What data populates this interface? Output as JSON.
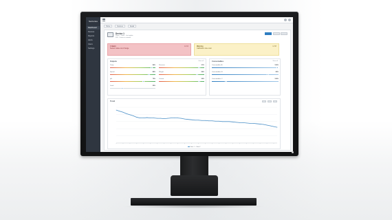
{
  "app": {
    "brand": "Sartorius",
    "colors": {
      "accent": "#2f7ec1",
      "sidebar": "#2f3640",
      "alert_red": "#f3c2c5",
      "alert_yellow": "#fbf1c7"
    }
  },
  "sidebar": {
    "items": [
      {
        "label": "Dashboard",
        "active": true
      },
      {
        "label": "Devices",
        "active": false
      },
      {
        "label": "Reports",
        "active": false
      },
      {
        "label": "Alerts",
        "active": false
      },
      {
        "label": "Users",
        "active": false
      },
      {
        "label": "Settings",
        "active": false
      }
    ]
  },
  "topbar": {
    "icons": [
      "menu-icon",
      "search-icon",
      "user-icon"
    ]
  },
  "breadcrumb": [
    "Home",
    "Devices",
    "Detail"
  ],
  "device": {
    "title": "Device 1",
    "subtitle": "Status · Online · Last update",
    "subtitle2": "S/N · 1 device in network"
  },
  "alerts": {
    "red": {
      "title": "1 Alarm",
      "text": "Sensor value out of range",
      "time": "12:04"
    },
    "yellow": {
      "title": "Warning",
      "text": "Calibration due soon",
      "time": "11:58"
    }
  },
  "panel_left": {
    "title": "Outputs",
    "link": "Show all",
    "metrics": [
      {
        "label": "Temp",
        "value": "94%",
        "level": 0.94
      },
      {
        "label": "Speed",
        "value": "88%",
        "level": 0.88
      },
      {
        "label": "pH",
        "value": "75%",
        "level": 0.75
      },
      {
        "label": "Pressure",
        "value": "91%",
        "level": 0.91
      },
      {
        "label": "Weight",
        "value": "86%",
        "level": 0.86
      },
      {
        "label": "Current",
        "value": "90%",
        "level": 0.9
      },
      {
        "label": "Level",
        "value": "25%",
        "level": 0.25
      }
    ]
  },
  "panel_right": {
    "title": "Consumables",
    "link": "Show all",
    "metrics": [
      {
        "label": "Consumables A",
        "value": "100%",
        "level": 1.0
      },
      {
        "label": "Consumables B",
        "value": "85%",
        "level": 0.85
      },
      {
        "label": "Consumables C",
        "value": "100%",
        "level": 0.2
      }
    ]
  },
  "trend": {
    "title": "Trend",
    "legend": "Value 1 — Value 2",
    "tools": [
      "zoom",
      "range",
      "export"
    ]
  },
  "chart_data": {
    "type": "line",
    "title": "Trend",
    "xlabel": "",
    "ylabel": "",
    "ylim": [
      0,
      100
    ],
    "x": [
      1,
      2,
      3,
      4,
      5,
      6,
      7,
      8,
      9,
      10,
      11,
      12,
      13,
      14,
      15,
      16,
      17,
      18,
      19,
      20,
      21,
      22,
      23,
      24,
      25,
      26,
      27,
      28,
      29,
      30,
      31,
      32,
      33,
      34,
      35,
      36,
      37,
      38,
      39,
      40,
      41,
      42,
      43,
      44,
      45,
      46,
      47,
      48
    ],
    "series": [
      {
        "values": [
          92,
          89,
          86,
          82,
          79,
          76,
          72,
          70,
          70,
          71,
          70,
          70,
          69,
          69,
          68,
          69,
          70,
          70,
          70,
          69,
          67,
          66,
          65,
          64,
          64,
          63,
          63,
          62,
          62,
          61,
          61,
          60,
          60,
          60,
          59,
          58,
          57,
          57,
          56,
          55,
          55,
          54,
          53,
          52,
          50,
          48,
          46,
          44
        ]
      }
    ]
  }
}
